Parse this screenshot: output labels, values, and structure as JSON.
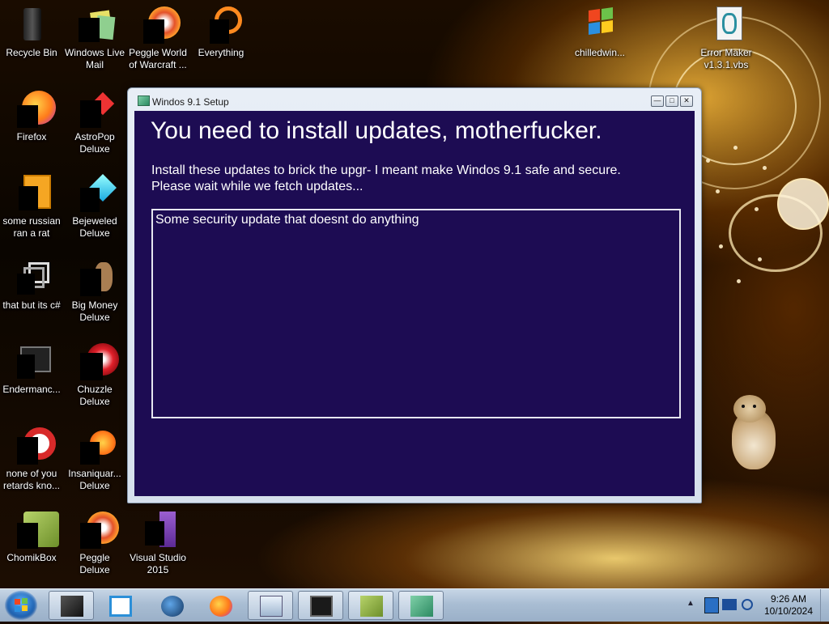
{
  "desktop": {
    "icons": [
      {
        "label": "Recycle Bin"
      },
      {
        "label": "Windows Live Mail"
      },
      {
        "label": "Peggle World of Warcraft ..."
      },
      {
        "label": "Everything"
      },
      {
        "label": "Firefox"
      },
      {
        "label": "AstroPop Deluxe"
      },
      {
        "label": "some russian ran a rat"
      },
      {
        "label": "Bejeweled Deluxe"
      },
      {
        "label": "that but its c#"
      },
      {
        "label": "Big Money Deluxe"
      },
      {
        "label": "Endermanc..."
      },
      {
        "label": "Chuzzle Deluxe"
      },
      {
        "label": "none of you retards kno..."
      },
      {
        "label": "Insaniquar... Deluxe"
      },
      {
        "label": "ChomikBox"
      },
      {
        "label": "Peggle Deluxe"
      },
      {
        "label": "Visual Studio 2015"
      },
      {
        "label": "chilledwin..."
      },
      {
        "label": "Error Maker v1.3.1.vbs"
      }
    ]
  },
  "window": {
    "title": "Windos 9.1 Setup",
    "headline": "You need to install updates, motherfucker.",
    "line1": "Install these updates to brick the upgr- I meant make Windos 9.1 safe and secure.",
    "line2": "Please wait while we fetch updates...",
    "updates": [
      "Some security update that doesnt do anything"
    ]
  },
  "taskbar": {
    "time": "9:26 AM",
    "date": "10/10/2024",
    "pinned": [
      "terminal-icon",
      "media-player-icon",
      "globe-icon",
      "firefox-icon",
      "calculator-icon",
      "display-icon",
      "chomikbox-icon",
      "setup-icon"
    ]
  }
}
